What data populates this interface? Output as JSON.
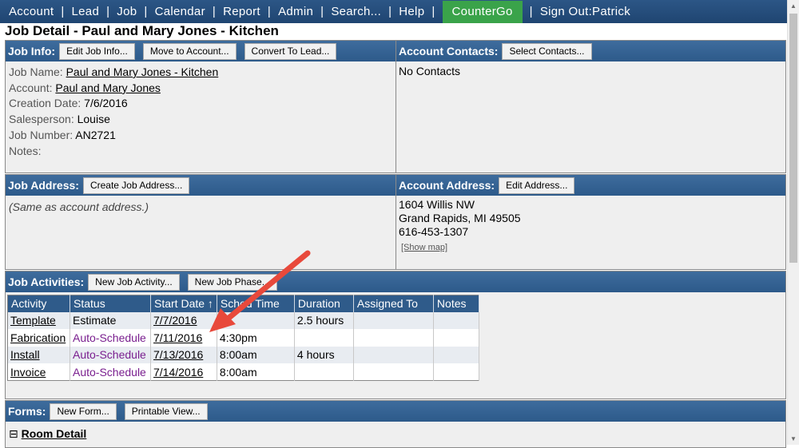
{
  "nav": {
    "items": [
      "Account",
      "Lead",
      "Job",
      "Calendar",
      "Report",
      "Admin",
      "Search...",
      "Help"
    ],
    "countergo": "CounterGo",
    "signout": "Sign Out:Patrick",
    "sep": "|"
  },
  "page_title": "Job Detail - Paul and Mary Jones - Kitchen",
  "job_info": {
    "title": "Job Info:",
    "buttons": [
      "Edit Job Info...",
      "Move to Account...",
      "Convert To Lead..."
    ],
    "fields": {
      "job_name_label": "Job Name:",
      "job_name": "Paul and Mary Jones - Kitchen",
      "account_label": "Account:",
      "account": "Paul and Mary Jones",
      "creation_label": "Creation Date:",
      "creation": "7/6/2016",
      "salesperson_label": "Salesperson:",
      "salesperson": "Louise",
      "job_number_label": "Job Number:",
      "job_number": "AN2721",
      "notes_label": "Notes:"
    }
  },
  "account_contacts": {
    "title": "Account Contacts:",
    "button": "Select Contacts...",
    "empty": "No Contacts"
  },
  "job_address": {
    "title": "Job Address:",
    "button": "Create Job Address...",
    "note": "(Same as account address.)"
  },
  "account_address": {
    "title": "Account Address:",
    "button": "Edit Address...",
    "line1": "1604 Willis NW",
    "line2": "Grand Rapids, MI 49505",
    "phone": "616-453-1307",
    "map_link": "[Show map]"
  },
  "job_activities": {
    "title": "Job Activities:",
    "buttons": [
      "New Job Activity...",
      "New Job Phase..."
    ],
    "columns": [
      "Activity",
      "Status",
      "Start Date ↑",
      "Sched Time",
      "Duration",
      "Assigned To",
      "Notes"
    ],
    "rows": [
      {
        "activity": "Template",
        "status": "Estimate",
        "start": "7/7/2016",
        "time": "",
        "duration": "2.5 hours",
        "assigned": "",
        "notes": ""
      },
      {
        "activity": "Fabrication",
        "status": "Auto-Schedule",
        "start": "7/11/2016",
        "time": "4:30pm",
        "duration": "",
        "assigned": "",
        "notes": ""
      },
      {
        "activity": "Install",
        "status": "Auto-Schedule",
        "start": "7/13/2016",
        "time": "8:00am",
        "duration": "4 hours",
        "assigned": "",
        "notes": ""
      },
      {
        "activity": "Invoice",
        "status": "Auto-Schedule",
        "start": "7/14/2016",
        "time": "8:00am",
        "duration": "",
        "assigned": "",
        "notes": ""
      }
    ]
  },
  "forms": {
    "title": "Forms:",
    "buttons": [
      "New Form...",
      "Printable View..."
    ],
    "room_detail": "Room Detail",
    "expand_glyph": "⊟"
  },
  "colors": {
    "nav_bg": "#1f4571",
    "panel_head": "#2d5a8a",
    "countergo": "#3aa34a",
    "auto_schedule": "#7a1f8f",
    "arrow": "#e8493b"
  },
  "scrollbar": {
    "up_icon": "▲",
    "down_icon": "▼"
  }
}
